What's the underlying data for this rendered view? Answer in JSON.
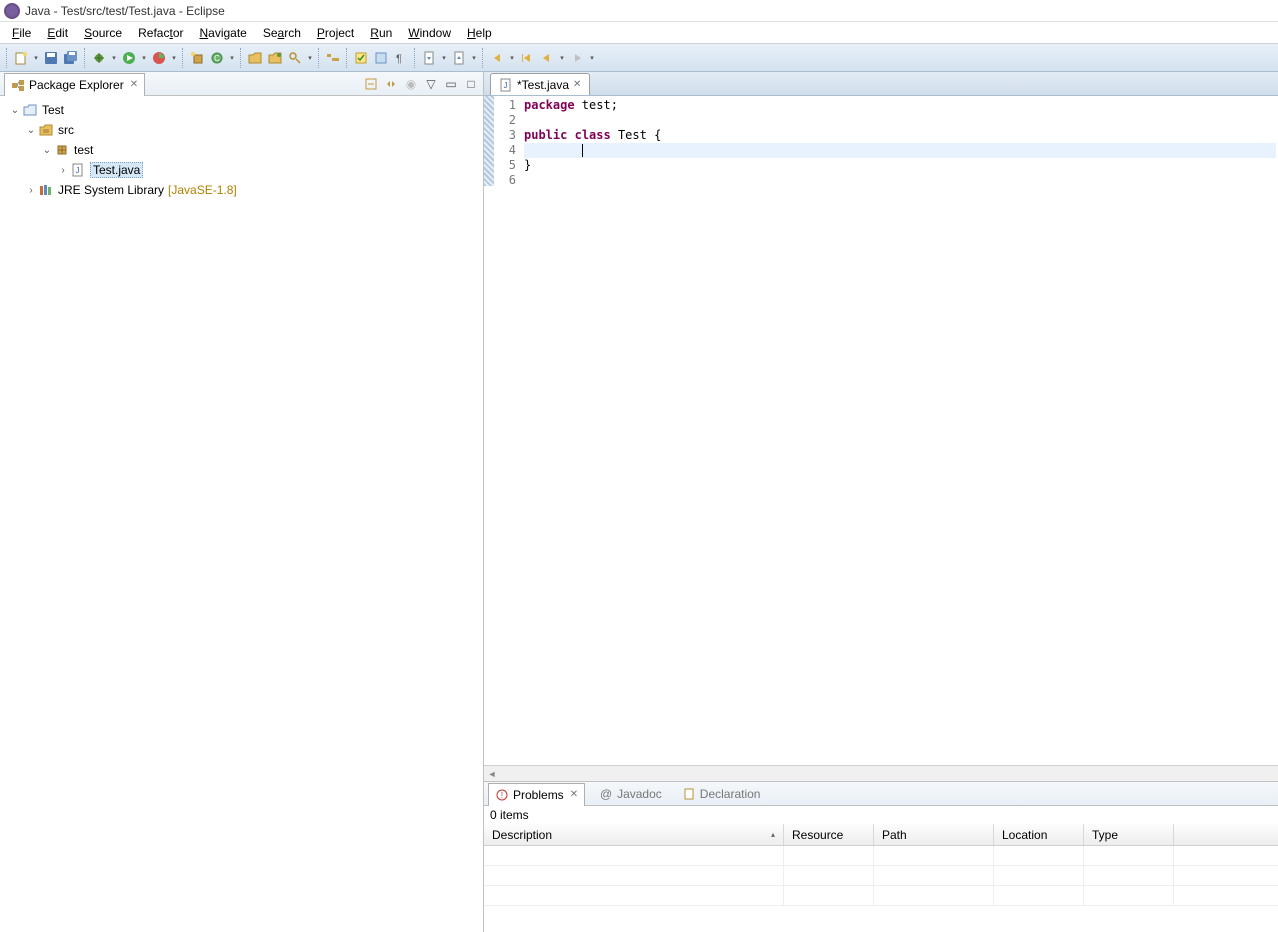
{
  "title": "Java - Test/src/test/Test.java - Eclipse",
  "menu": {
    "file": "File",
    "edit": "Edit",
    "source": "Source",
    "refactor": "Refactor",
    "navigate": "Navigate",
    "search": "Search",
    "project": "Project",
    "run": "Run",
    "window": "Window",
    "help": "Help"
  },
  "pkgExplorer": {
    "title": "Package Explorer",
    "tree": {
      "project": "Test",
      "srcFolder": "src",
      "pkg": "test",
      "file": "Test.java",
      "jre": "JRE System Library",
      "jreExtra": "[JavaSE-1.8]"
    }
  },
  "editor": {
    "tab": "*Test.java",
    "lines": {
      "l1a": "package",
      "l1b": " test;",
      "l2": "",
      "l3a": "public",
      "l3b": " ",
      "l3c": "class",
      "l3d": " Test {",
      "l4": "\t",
      "l5": "}",
      "l6": ""
    },
    "lineNums": [
      "1",
      "2",
      "3",
      "4",
      "5",
      "6"
    ]
  },
  "bottom": {
    "problems": "Problems",
    "javadoc": "Javadoc",
    "declaration": "Declaration",
    "itemsCount": "0 items",
    "cols": {
      "desc": "Description",
      "res": "Resource",
      "path": "Path",
      "loc": "Location",
      "type": "Type"
    }
  }
}
